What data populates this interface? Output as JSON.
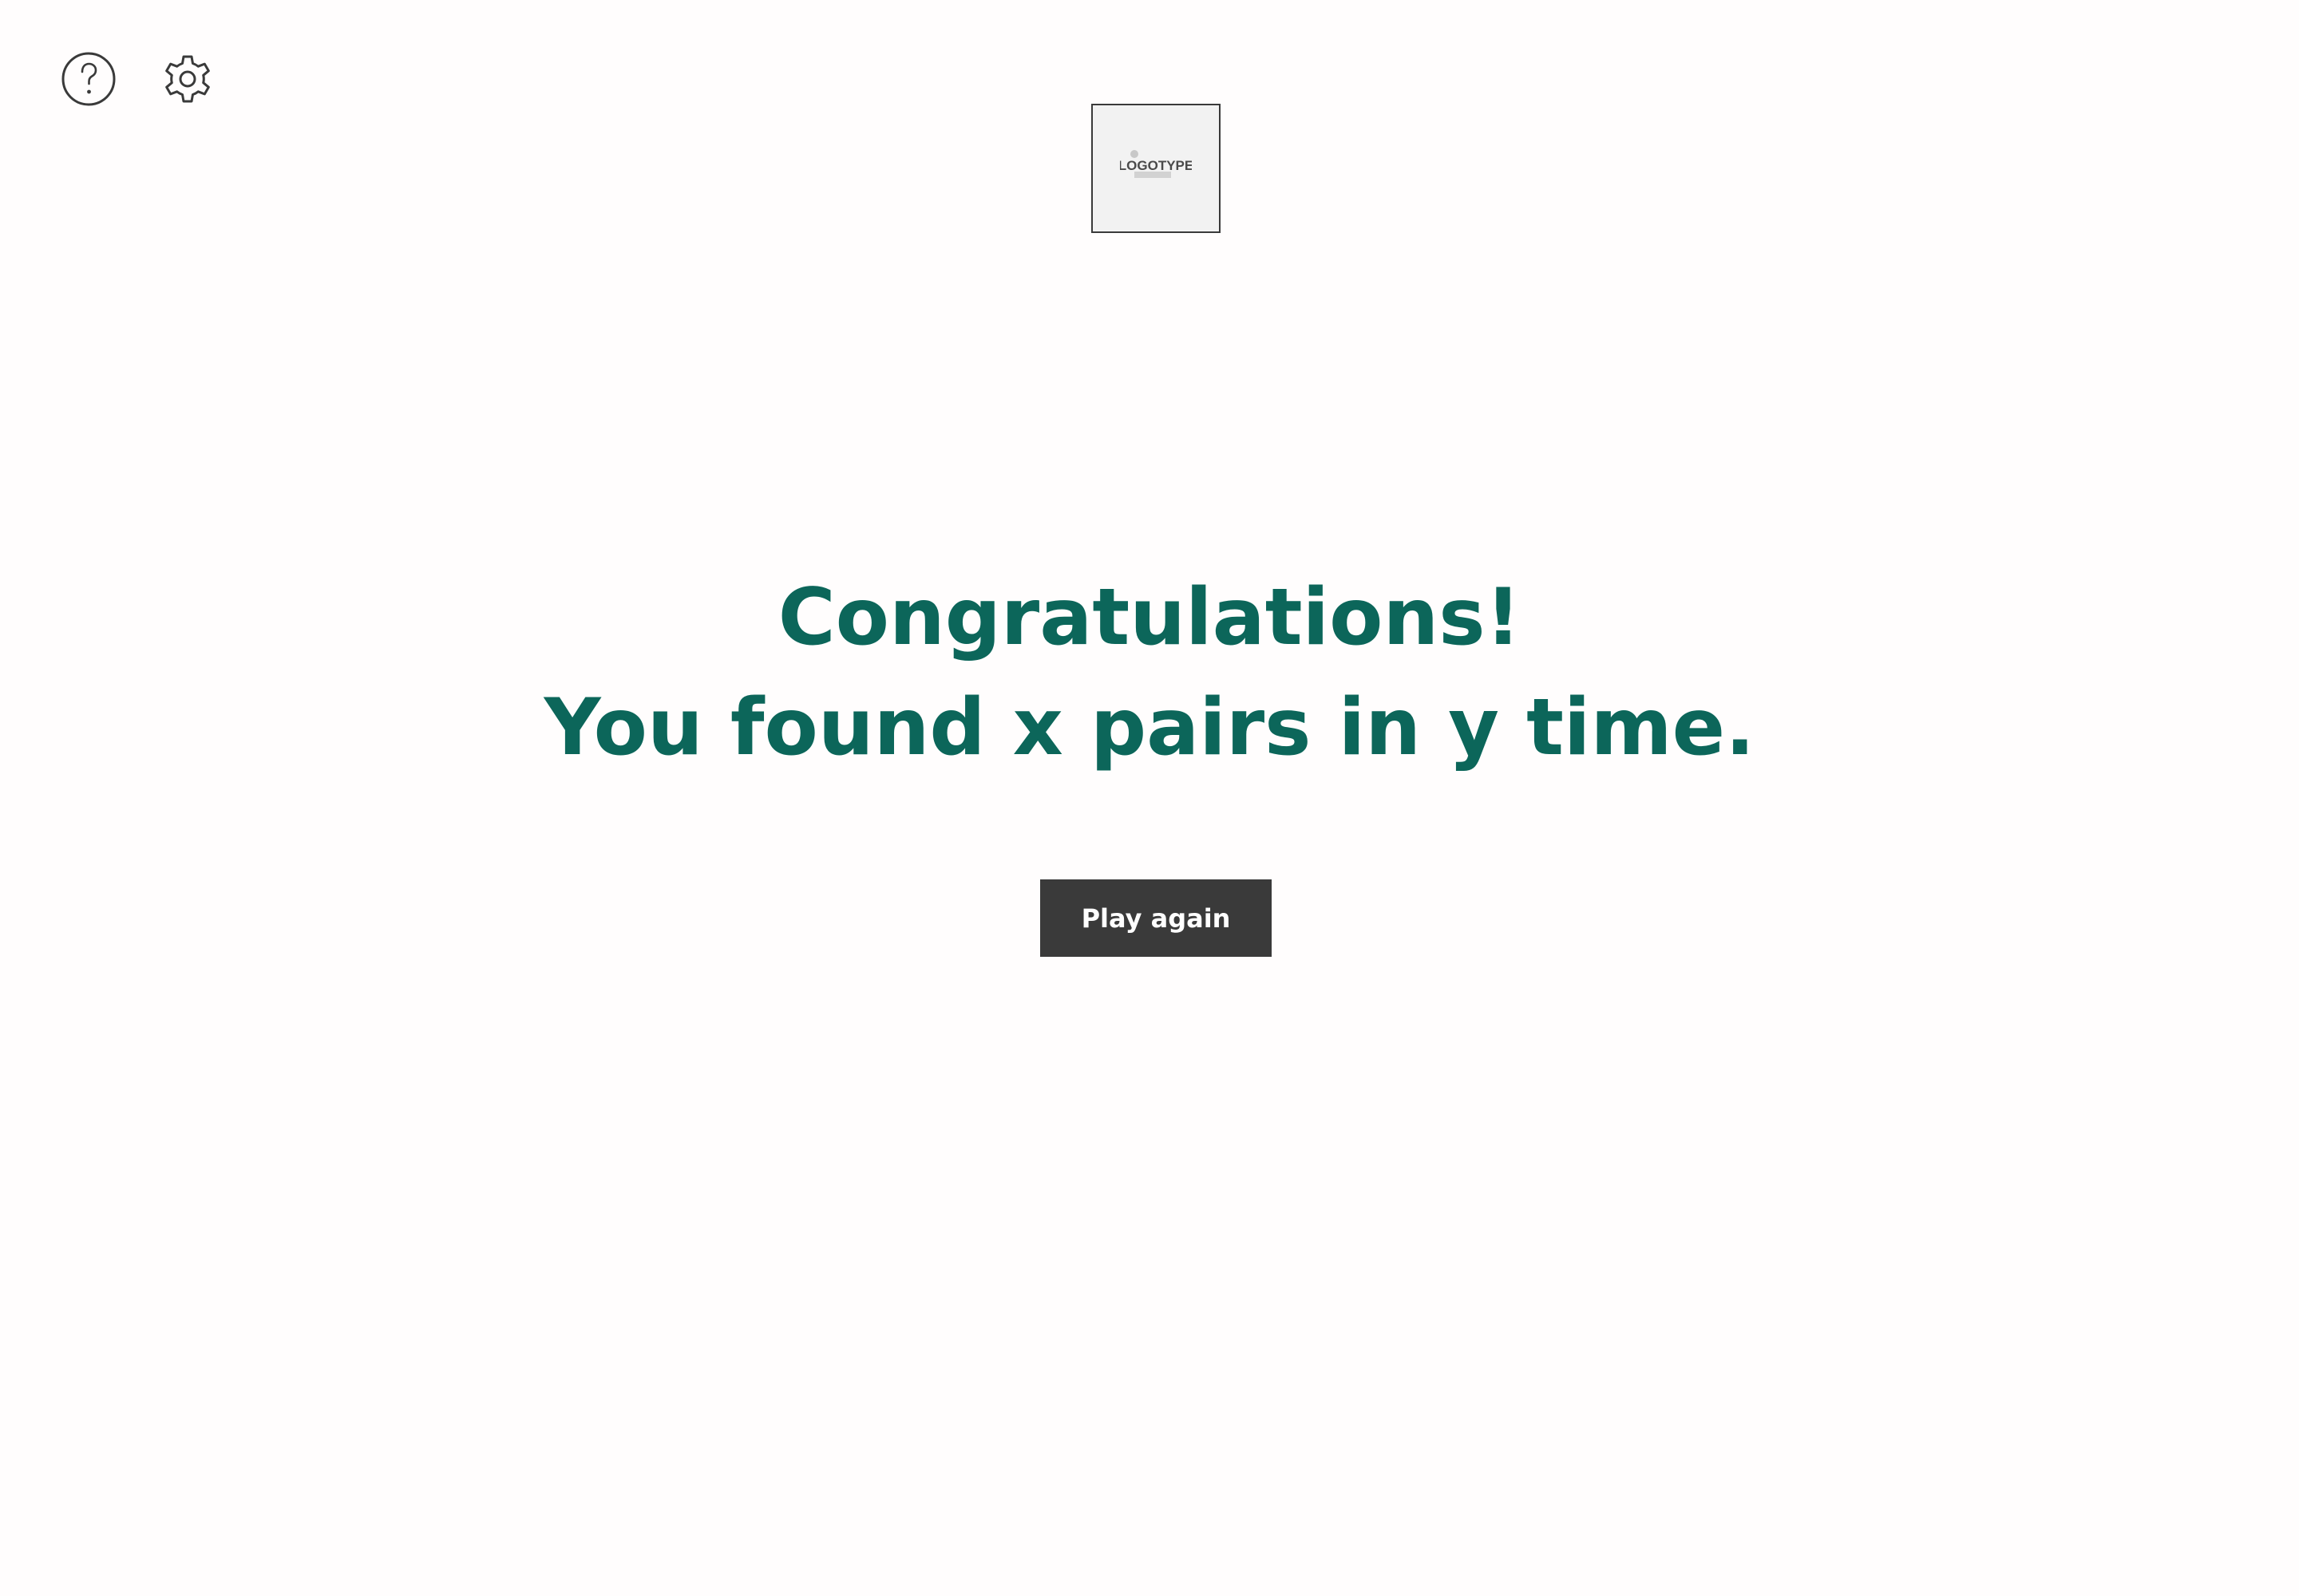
{
  "toolbar": {
    "icons": [
      "help-icon",
      "gear-icon"
    ]
  },
  "logo": {
    "text": "LOGOTYPE"
  },
  "result": {
    "line1": "Congratulations!",
    "line2": "You found x pairs in y time."
  },
  "actions": {
    "play_again_label": "Play again"
  },
  "colors": {
    "heading": "#0c665a",
    "button_bg": "#3a3a3a",
    "button_text": "#ffffff",
    "icon_stroke": "#3a3a3a",
    "logo_bg": "#f2f2f2"
  }
}
